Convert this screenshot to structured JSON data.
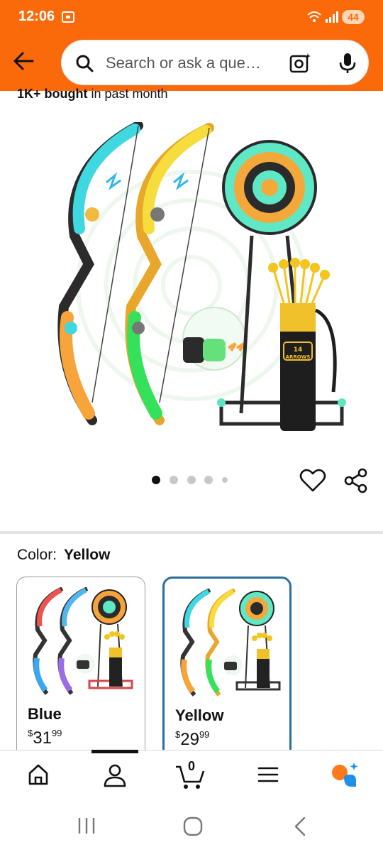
{
  "status": {
    "time": "12:06",
    "battery": "44"
  },
  "search": {
    "placeholder": "Search or ask a que…"
  },
  "product": {
    "bought_strong": "1K+ bought",
    "bought_rest": " in past month",
    "image_badge_count": "14",
    "image_badge_text": "ARROWS",
    "image_count": 5,
    "current_image": 1
  },
  "color": {
    "label": "Color:",
    "selected": "Yellow",
    "options": [
      {
        "name": "Blue",
        "currency": "$",
        "whole": "31",
        "fraction": "99"
      },
      {
        "name": "Yellow",
        "currency": "$",
        "whole": "29",
        "fraction": "99"
      }
    ]
  },
  "nav": {
    "cart_count": "0"
  },
  "colors": {
    "brand": "#fa6a0a",
    "selected_border": "#2c6e9b"
  },
  "icons": [
    "back-arrow-icon",
    "search-icon",
    "camera-scan-icon",
    "microphone-icon",
    "heart-icon",
    "share-icon",
    "home-icon",
    "account-icon",
    "cart-icon",
    "menu-icon",
    "rufus-ai-icon"
  ]
}
